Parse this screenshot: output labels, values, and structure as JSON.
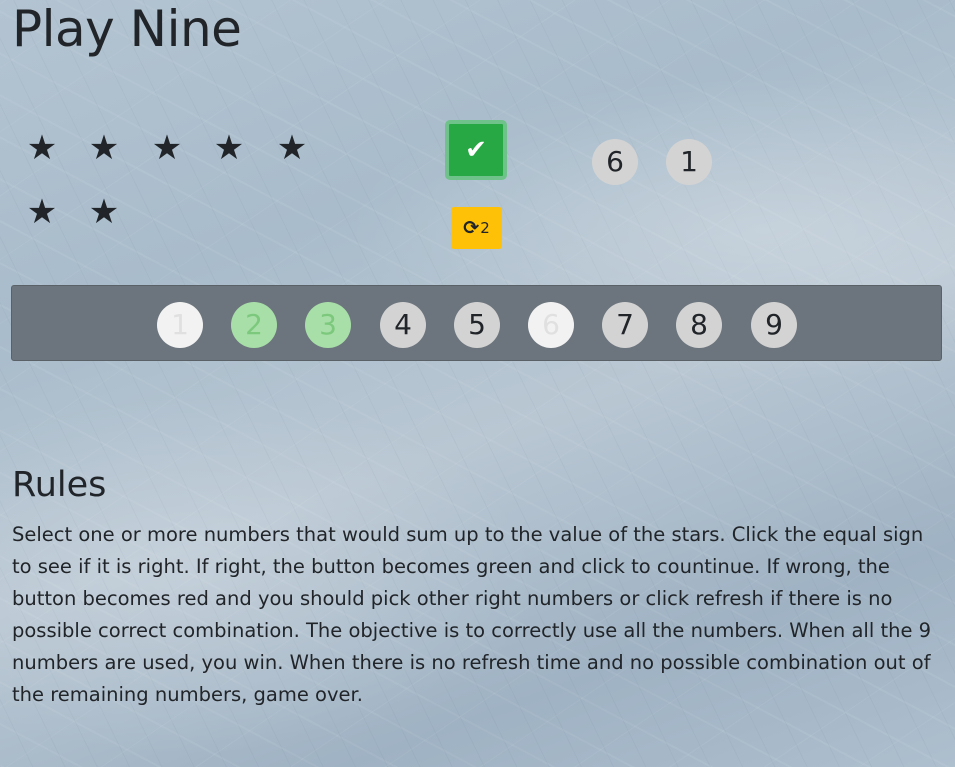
{
  "title": "Play Nine",
  "stars": {
    "count": 7,
    "glyph": "★"
  },
  "check_button": {
    "state": "correct",
    "glyph": "✔",
    "color": "#28a745"
  },
  "refresh_button": {
    "glyph": "⟳",
    "remaining": "2",
    "color": "#ffc107"
  },
  "selected_numbers": [
    "6",
    "1"
  ],
  "numbers_panel": {
    "numbers": [
      {
        "label": "1",
        "state": "used"
      },
      {
        "label": "2",
        "state": "selected"
      },
      {
        "label": "3",
        "state": "selected"
      },
      {
        "label": "4",
        "state": "available"
      },
      {
        "label": "5",
        "state": "available"
      },
      {
        "label": "6",
        "state": "used"
      },
      {
        "label": "7",
        "state": "available"
      },
      {
        "label": "8",
        "state": "available"
      },
      {
        "label": "9",
        "state": "available"
      }
    ],
    "color": "#6c757d"
  },
  "rules": {
    "title": "Rules",
    "text": "Select one or more numbers that would sum up to the value of the stars. Click the equal sign to see if it is right. If right, the button becomes green and click to countinue. If wrong, the button becomes red and you should pick other right numbers or click refresh if there is no possible correct combination. The objective is to correctly use all the numbers. When all the 9 numbers are used, you win. When there is no refresh time and no possible combination out of the remaining numbers, game over."
  }
}
